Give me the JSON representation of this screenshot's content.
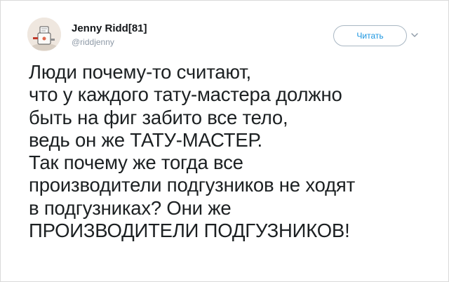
{
  "author": {
    "display_name": "Jenny Ridd[81]",
    "handle": "@riddjenny"
  },
  "actions": {
    "follow_label": "Читать"
  },
  "icons": {
    "avatar": "avatar-illustration",
    "more": "chevron-down-icon"
  },
  "tweet": {
    "lines": [
      "Люди почему-то считают,",
      "что у каждого тату-мастера должно",
      "быть на фиг забито все тело,",
      "ведь он же ТАТУ-МАСТЕР.",
      "Так почему же тогда все",
      "производители подгузников не ходят",
      "в подгузниках? Они же",
      "ПРОИЗВОДИТЕЛИ ПОДГУЗНИКОВ!"
    ]
  },
  "colors": {
    "link": "#1b95e0",
    "text": "#1c2022",
    "secondary": "#8d99a6"
  }
}
